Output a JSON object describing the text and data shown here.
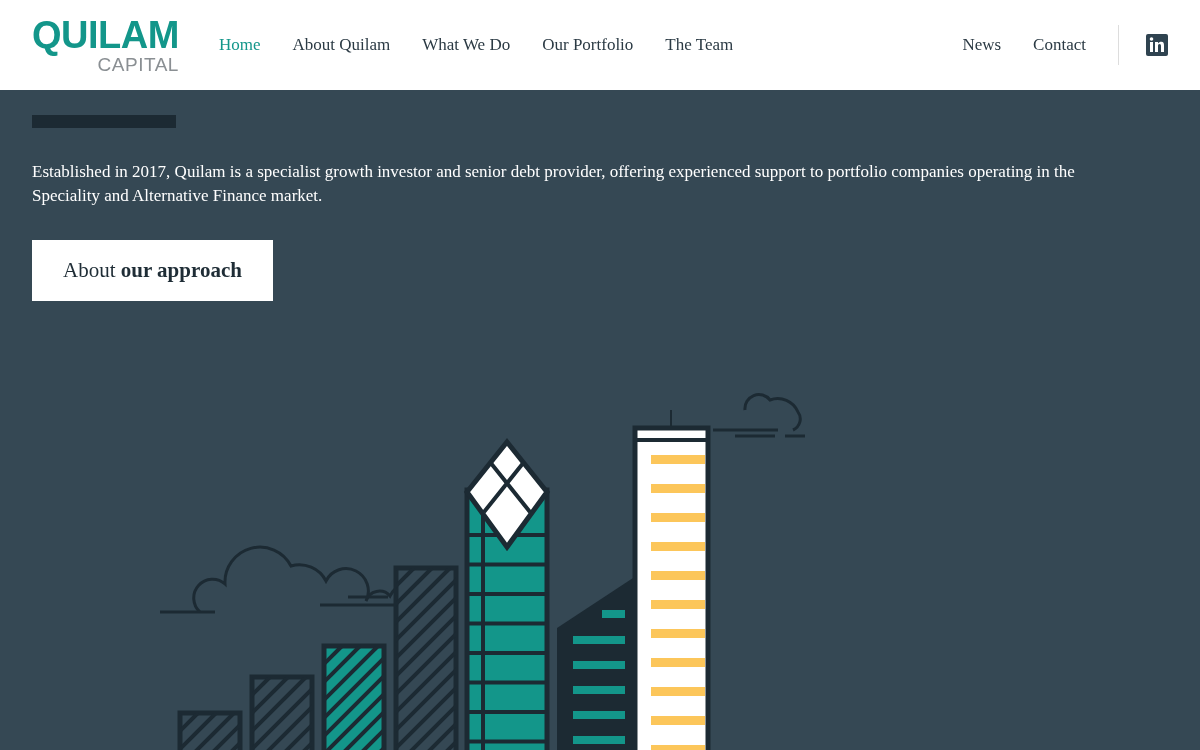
{
  "header": {
    "logo": {
      "name": "QUILAM",
      "tagline": "CAPITAL"
    },
    "nav": [
      {
        "label": "Home",
        "selected": true
      },
      {
        "label": "About Quilam",
        "selected": false
      },
      {
        "label": "What We Do",
        "selected": false
      },
      {
        "label": "Our Portfolio",
        "selected": false
      },
      {
        "label": "The Team",
        "selected": false
      }
    ],
    "nav_right": [
      {
        "label": "News",
        "selected": false
      },
      {
        "label": "Contact",
        "selected": false
      }
    ]
  },
  "hero": {
    "intro": "Established in 2017, Quilam is a specialist growth investor and senior debt provider, offering experienced support to portfolio companies operating in the Speciality and Alternative Finance market.",
    "button": "About **our approach**"
  }
}
